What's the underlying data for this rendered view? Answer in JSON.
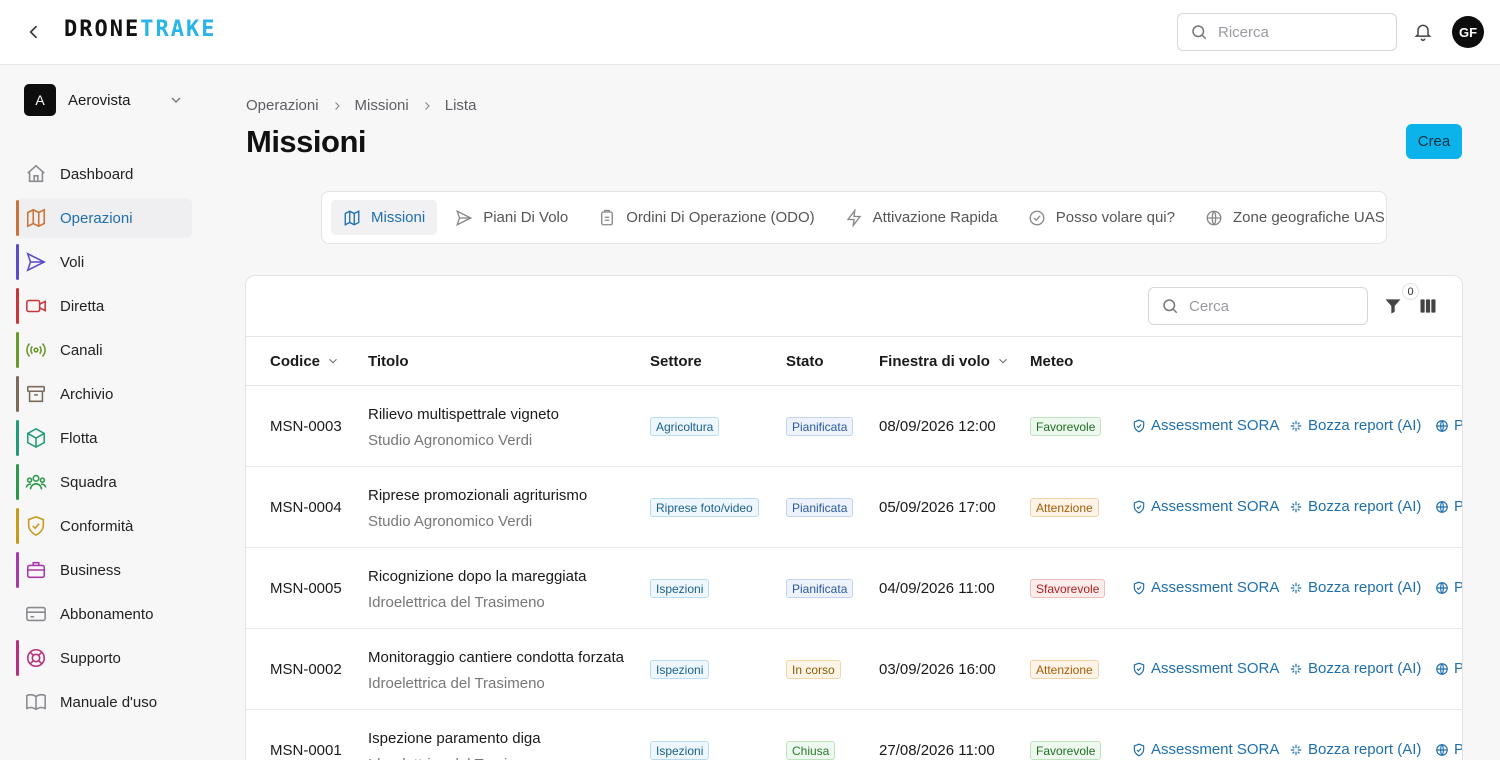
{
  "header": {
    "logo_part1": "DRONE",
    "logo_part2": "TRAKE",
    "search_placeholder": "Ricerca",
    "avatar_initials": "GF"
  },
  "org": {
    "initial": "A",
    "name": "Aerovista"
  },
  "sidebar": {
    "items": [
      {
        "label": "Dashboard",
        "icon": "home-icon",
        "color": "#8a8a90",
        "active": false
      },
      {
        "label": "Operazioni",
        "icon": "map-icon",
        "color": "#c9743a",
        "active": true
      },
      {
        "label": "Voli",
        "icon": "send-icon",
        "color": "#5a4cc8",
        "active": false
      },
      {
        "label": "Diretta",
        "icon": "video-icon",
        "color": "#c8363a",
        "active": false
      },
      {
        "label": "Canali",
        "icon": "broadcast-icon",
        "color": "#6a9a2a",
        "active": false
      },
      {
        "label": "Archivio",
        "icon": "archive-icon",
        "color": "#7a6a5a",
        "active": false
      },
      {
        "label": "Flotta",
        "icon": "box-icon",
        "color": "#1f9a7a",
        "active": false
      },
      {
        "label": "Squadra",
        "icon": "users-icon",
        "color": "#2a9a4a",
        "active": false
      },
      {
        "label": "Conformità",
        "icon": "shield-check-icon",
        "color": "#c89a1a",
        "active": false
      },
      {
        "label": "Business",
        "icon": "briefcase-icon",
        "color": "#a83aa8",
        "active": false
      },
      {
        "label": "Abbonamento",
        "icon": "credit-card-icon",
        "color": "#8a8a90",
        "active": false
      },
      {
        "label": "Supporto",
        "icon": "lifebuoy-icon",
        "color": "#b8307a",
        "active": false
      },
      {
        "label": "Manuale d'uso",
        "icon": "book-icon",
        "color": "#8a8a90",
        "active": false
      }
    ]
  },
  "breadcrumb": [
    "Operazioni",
    "Missioni",
    "Lista"
  ],
  "page": {
    "title": "Missioni",
    "create_label": "Crea"
  },
  "tabs": [
    {
      "label": "Missioni",
      "icon": "map-icon",
      "active": true
    },
    {
      "label": "Piani Di Volo",
      "icon": "send-icon",
      "active": false
    },
    {
      "label": "Ordini Di Operazione (ODO)",
      "icon": "clipboard-icon",
      "active": false
    },
    {
      "label": "Attivazione Rapida",
      "icon": "zap-icon",
      "active": false
    },
    {
      "label": "Posso volare qui?",
      "icon": "check-circle-icon",
      "active": false
    },
    {
      "label": "Zone geografiche UAS",
      "icon": "globe-icon",
      "active": false
    }
  ],
  "table": {
    "search_placeholder": "Cerca",
    "filter_count": "0",
    "columns": [
      "Codice",
      "Titolo",
      "Settore",
      "Stato",
      "Finestra di volo",
      "Meteo"
    ],
    "actions": [
      "Assessment SORA",
      "Bozza report (AI)",
      "P"
    ],
    "rows": [
      {
        "code": "MSN-0003",
        "title": "Rilievo multispettrale vigneto",
        "client": "Studio Agronomico Verdi",
        "sector": "Agricoltura",
        "state": "Pianificata",
        "state_kind": "plan",
        "window": "08/09/2026 12:00",
        "meteo": "Favorevole",
        "meteo_kind": "good"
      },
      {
        "code": "MSN-0004",
        "title": "Riprese promozionali agriturismo",
        "client": "Studio Agronomico Verdi",
        "sector": "Riprese foto/video",
        "state": "Pianificata",
        "state_kind": "plan",
        "window": "05/09/2026 17:00",
        "meteo": "Attenzione",
        "meteo_kind": "warn"
      },
      {
        "code": "MSN-0005",
        "title": "Ricognizione dopo la mareggiata",
        "client": "Idroelettrica del Trasimeno",
        "sector": "Ispezioni",
        "state": "Pianificata",
        "state_kind": "plan",
        "window": "04/09/2026 11:00",
        "meteo": "Sfavorevole",
        "meteo_kind": "bad"
      },
      {
        "code": "MSN-0002",
        "title": "Monitoraggio cantiere condotta forzata",
        "client": "Idroelettrica del Trasimeno",
        "sector": "Ispezioni",
        "state": "In corso",
        "state_kind": "run",
        "window": "03/09/2026 16:00",
        "meteo": "Attenzione",
        "meteo_kind": "warn"
      },
      {
        "code": "MSN-0001",
        "title": "Ispezione paramento diga",
        "client": "Idroelettrica del Trasimeno",
        "sector": "Ispezioni",
        "state": "Chiusa",
        "state_kind": "closed",
        "window": "27/08/2026 11:00",
        "meteo": "Favorevole",
        "meteo_kind": "good"
      }
    ]
  }
}
